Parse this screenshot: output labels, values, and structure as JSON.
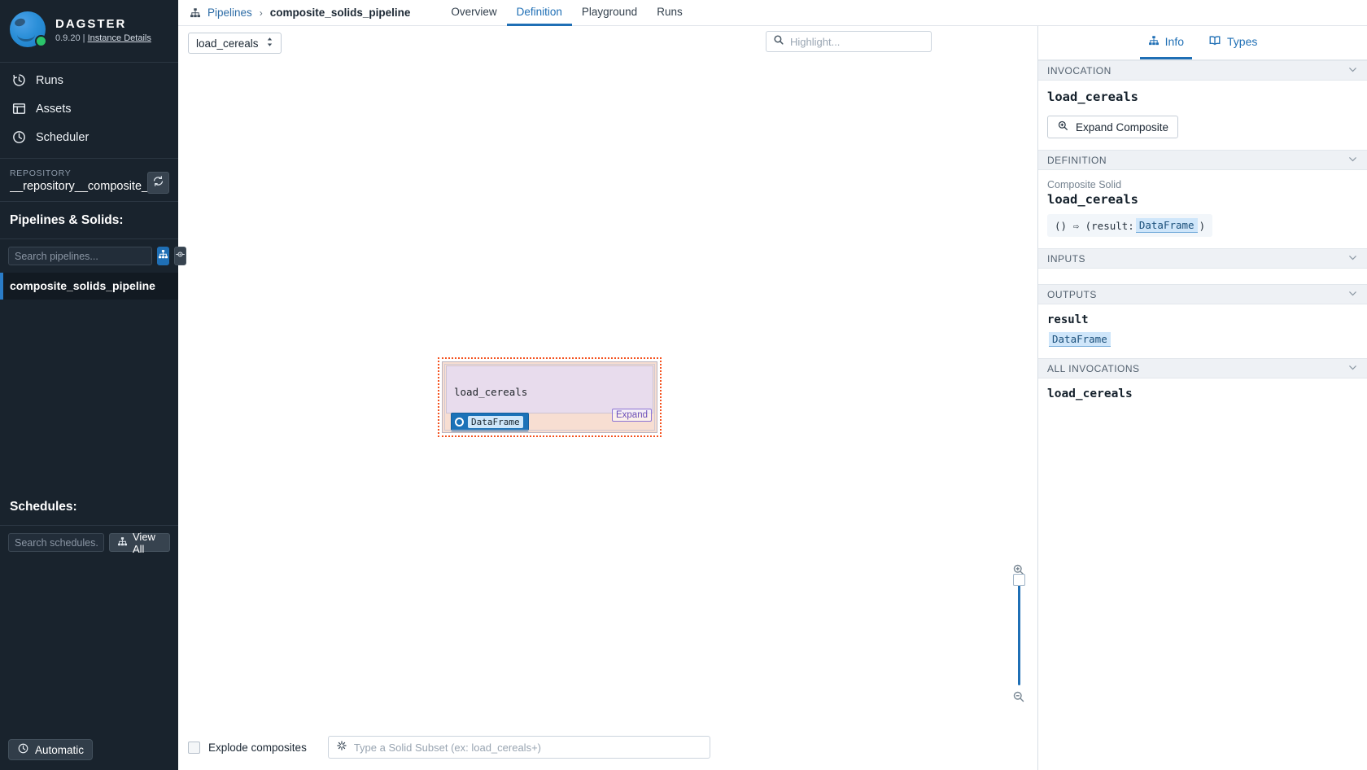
{
  "sidebar": {
    "brand": {
      "title": "DAGSTER",
      "version": "0.9.20",
      "separator": "|",
      "instance_link": "Instance Details"
    },
    "nav": [
      {
        "label": "Runs",
        "icon": "history-icon"
      },
      {
        "label": "Assets",
        "icon": "table-icon"
      },
      {
        "label": "Scheduler",
        "icon": "clock-icon"
      }
    ],
    "repository": {
      "label": "REPOSITORY",
      "name": "__repository__composite_solids",
      "refresh_icon": "refresh-icon"
    },
    "pipelines_section": {
      "title": "Pipelines & Solids:",
      "search_placeholder": "Search pipelines...",
      "search_value": ""
    },
    "view_toggles": {
      "graph_icon": "pipeline-graph-icon",
      "solid_icon": "solid-node-icon"
    },
    "pipelines": [
      {
        "label": "composite_solids_pipeline",
        "selected": true
      }
    ],
    "schedules_section": {
      "title": "Schedules:",
      "search_placeholder": "Search schedules...",
      "search_value": "",
      "view_all_label": "View All",
      "view_all_icon": "pipeline-graph-icon"
    },
    "footer": {
      "status_label": "Automatic",
      "status_icon": "clock-icon"
    }
  },
  "topbar": {
    "breadcrumb_icon": "pipeline-graph-icon",
    "breadcrumb_root": "Pipelines",
    "breadcrumb_sep": "›",
    "breadcrumb_current": "composite_solids_pipeline",
    "tabs": [
      {
        "label": "Overview",
        "active": false
      },
      {
        "label": "Definition",
        "active": true
      },
      {
        "label": "Playground",
        "active": false
      },
      {
        "label": "Runs",
        "active": false
      }
    ]
  },
  "canvas_toolbar": {
    "solid_select_value": "load_cereals",
    "solid_select_icon": "chevron-updown-icon",
    "highlight_icon": "search-icon",
    "highlight_placeholder": "Highlight...",
    "highlight_value": ""
  },
  "graph": {
    "node": {
      "title": "load_cereals",
      "output_port_label": "DataFrame",
      "expand_badge": "Expand",
      "selected": true
    },
    "zoom": {
      "in_icon": "zoom-in-icon",
      "out_icon": "zoom-out-icon"
    }
  },
  "bottom_bar": {
    "explode_label": "Explode composites",
    "explode_checked": false,
    "subset_icon": "solid-subset-icon",
    "subset_placeholder": "Type a Solid Subset (ex: load_cereals+)",
    "subset_value": ""
  },
  "right_panel": {
    "tabs": [
      {
        "label": "Info",
        "icon": "pipeline-graph-icon",
        "active": true
      },
      {
        "label": "Types",
        "icon": "book-icon",
        "active": false
      }
    ],
    "sections": {
      "invocation": {
        "header": "INVOCATION",
        "name": "load_cereals",
        "expand_button": "Expand Composite",
        "expand_icon": "zoom-in-icon",
        "chevron": "chevron-down-icon"
      },
      "definition": {
        "header": "DEFINITION",
        "kind": "Composite Solid",
        "name": "load_cereals",
        "signature_prefix": "() ⇨ (result:",
        "signature_type": "DataFrame",
        "signature_suffix": ")",
        "chevron": "chevron-down-icon"
      },
      "inputs": {
        "header": "INPUTS",
        "items": [],
        "chevron": "chevron-down-icon"
      },
      "outputs": {
        "header": "OUTPUTS",
        "chevron": "chevron-down-icon",
        "items": [
          {
            "name": "result",
            "type": "DataFrame"
          }
        ]
      },
      "all_invocations": {
        "header": "ALL INVOCATIONS",
        "chevron": "chevron-down-icon",
        "items": [
          {
            "name": "load_cereals"
          }
        ]
      }
    }
  },
  "colors": {
    "sidebar_bg": "#19232d",
    "accent_blue": "#1f6fb5",
    "selection_orange": "#f4511e",
    "node_body": "#e8dced",
    "node_frame": "#f7ded2",
    "status_green": "#2bc46a"
  }
}
